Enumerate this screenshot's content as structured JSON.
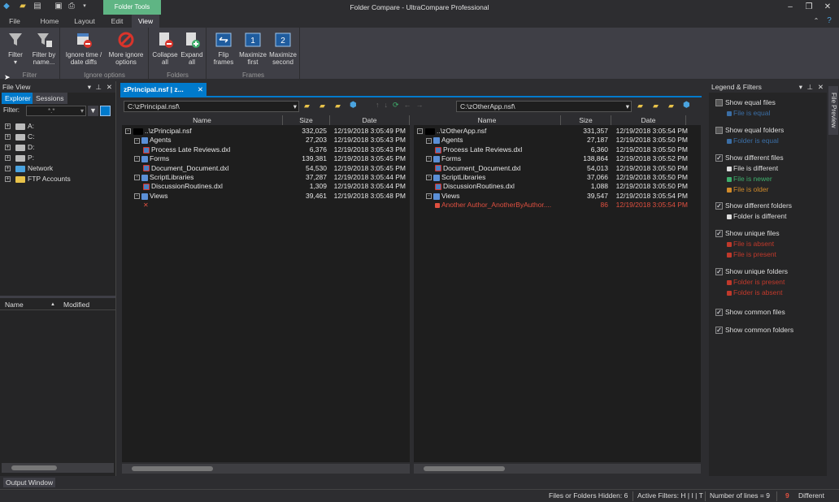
{
  "window": {
    "title": "Folder Compare - UltraCompare Professional",
    "context_tab": "Folder Tools"
  },
  "ribbon_tabs": [
    "File",
    "Home",
    "Layout",
    "Edit",
    "View"
  ],
  "ribbon": {
    "groups": [
      {
        "label": "Filter",
        "buttons": [
          "Filter",
          "Filter by name..."
        ]
      },
      {
        "label": "Ignore options",
        "buttons": [
          "Ignore time / date diffs",
          "More ignore options"
        ]
      },
      {
        "label": "Folders",
        "buttons": [
          "Collapse all",
          "Expand all"
        ]
      },
      {
        "label": "Frames",
        "buttons": [
          "Flip frames",
          "Maximize first",
          "Maximize second"
        ]
      }
    ]
  },
  "file_view": {
    "title": "File View",
    "tabs": [
      "Explorer",
      "Sessions"
    ],
    "filter_label": "Filter:",
    "filter_value": "*.*",
    "drives": [
      "A:",
      "C:",
      "D:",
      "P:",
      "Network",
      "FTP Accounts"
    ],
    "list_columns": [
      "Name",
      "Modified"
    ]
  },
  "doc_tab": "zPrincipal.nsf | z...",
  "left": {
    "path": "C:\\zPrincipal.nsf\\",
    "columns": [
      "Name",
      "Size",
      "Date"
    ],
    "rows": [
      {
        "name": "..\\zPrincipal.nsf",
        "size": "332,025",
        "date": "12/19/2018 3:05:49 PM",
        "level": 0,
        "kind": "root"
      },
      {
        "name": "Agents",
        "size": "27,203",
        "date": "12/19/2018 3:05:43 PM",
        "level": 1,
        "kind": "folder"
      },
      {
        "name": "Process Late Reviews.dxl",
        "size": "6,376",
        "date": "12/19/2018 3:05:43 PM",
        "level": 2,
        "kind": "file"
      },
      {
        "name": "Forms",
        "size": "139,381",
        "date": "12/19/2018 3:05:45 PM",
        "level": 1,
        "kind": "folder"
      },
      {
        "name": "Document_Document.dxl",
        "size": "54,530",
        "date": "12/19/2018 3:05:45 PM",
        "level": 2,
        "kind": "file"
      },
      {
        "name": "ScriptLibraries",
        "size": "37,287",
        "date": "12/19/2018 3:05:44 PM",
        "level": 1,
        "kind": "folder"
      },
      {
        "name": "DiscussionRoutines.dxl",
        "size": "1,309",
        "date": "12/19/2018 3:05:44 PM",
        "level": 2,
        "kind": "file"
      },
      {
        "name": "Views",
        "size": "39,461",
        "date": "12/19/2018 3:05:48 PM",
        "level": 1,
        "kind": "folder"
      },
      {
        "name": "",
        "size": "",
        "date": "",
        "level": 2,
        "kind": "absent"
      }
    ]
  },
  "right": {
    "path": "C:\\zOtherApp.nsf\\",
    "columns": [
      "Name",
      "Size",
      "Date"
    ],
    "rows": [
      {
        "name": "..\\zOtherApp.nsf",
        "size": "331,357",
        "date": "12/19/2018 3:05:54 PM",
        "level": 0,
        "kind": "root"
      },
      {
        "name": "Agents",
        "size": "27,187",
        "date": "12/19/2018 3:05:50 PM",
        "level": 1,
        "kind": "folder"
      },
      {
        "name": "Process Late Reviews.dxl",
        "size": "6,360",
        "date": "12/19/2018 3:05:50 PM",
        "level": 2,
        "kind": "file"
      },
      {
        "name": "Forms",
        "size": "138,864",
        "date": "12/19/2018 3:05:52 PM",
        "level": 1,
        "kind": "folder"
      },
      {
        "name": "Document_Document.dxl",
        "size": "54,013",
        "date": "12/19/2018 3:05:50 PM",
        "level": 2,
        "kind": "file"
      },
      {
        "name": "ScriptLibraries",
        "size": "37,066",
        "date": "12/19/2018 3:05:50 PM",
        "level": 1,
        "kind": "folder"
      },
      {
        "name": "DiscussionRoutines.dxl",
        "size": "1,088",
        "date": "12/19/2018 3:05:50 PM",
        "level": 2,
        "kind": "file"
      },
      {
        "name": "Views",
        "size": "39,547",
        "date": "12/19/2018 3:05:54 PM",
        "level": 1,
        "kind": "folder"
      },
      {
        "name": "Another Author_AnotherByAuthor....",
        "size": "86",
        "date": "12/19/2018 3:05:54 PM",
        "level": 2,
        "kind": "unique"
      }
    ]
  },
  "legend": {
    "title": "Legend & Filters",
    "items": [
      {
        "label": "Show equal files",
        "checked": false,
        "subs": [
          {
            "text": "File is equal",
            "color": "#3b6ea5"
          }
        ]
      },
      {
        "label": "Show equal folders",
        "checked": false,
        "subs": [
          {
            "text": "Folder is equal",
            "color": "#3b6ea5"
          }
        ]
      },
      {
        "label": "Show different files",
        "checked": true,
        "subs": [
          {
            "text": "File is different",
            "color": "#dddddd"
          },
          {
            "text": "File is newer",
            "color": "#3fae6c"
          },
          {
            "text": "File is older",
            "color": "#d08a2a"
          }
        ]
      },
      {
        "label": "Show different folders",
        "checked": true,
        "subs": [
          {
            "text": "Folder is different",
            "color": "#dddddd"
          }
        ]
      },
      {
        "label": "Show unique files",
        "checked": true,
        "subs": [
          {
            "text": "File is absent",
            "color": "#c0392b"
          },
          {
            "text": "File is present",
            "color": "#c0392b"
          }
        ]
      },
      {
        "label": "Show unique folders",
        "checked": true,
        "subs": [
          {
            "text": "Folder is present",
            "color": "#c0392b"
          },
          {
            "text": "Folder is absent",
            "color": "#c0392b"
          }
        ]
      },
      {
        "label": "Show common files",
        "checked": true,
        "subs": []
      },
      {
        "label": "Show common folders",
        "checked": true,
        "subs": []
      }
    ]
  },
  "file_preview": "File Preview",
  "output_window": "Output Window",
  "status": {
    "hidden": "Files or Folders Hidden: 6",
    "filters": "Active Filters: H | I | T",
    "lines": "Number of lines = 9",
    "diff_count": "9",
    "diff_label": "Different"
  },
  "colors": {
    "accent": "#007acc",
    "context_tab": "#5fb584",
    "diff_red": "#e05040"
  }
}
